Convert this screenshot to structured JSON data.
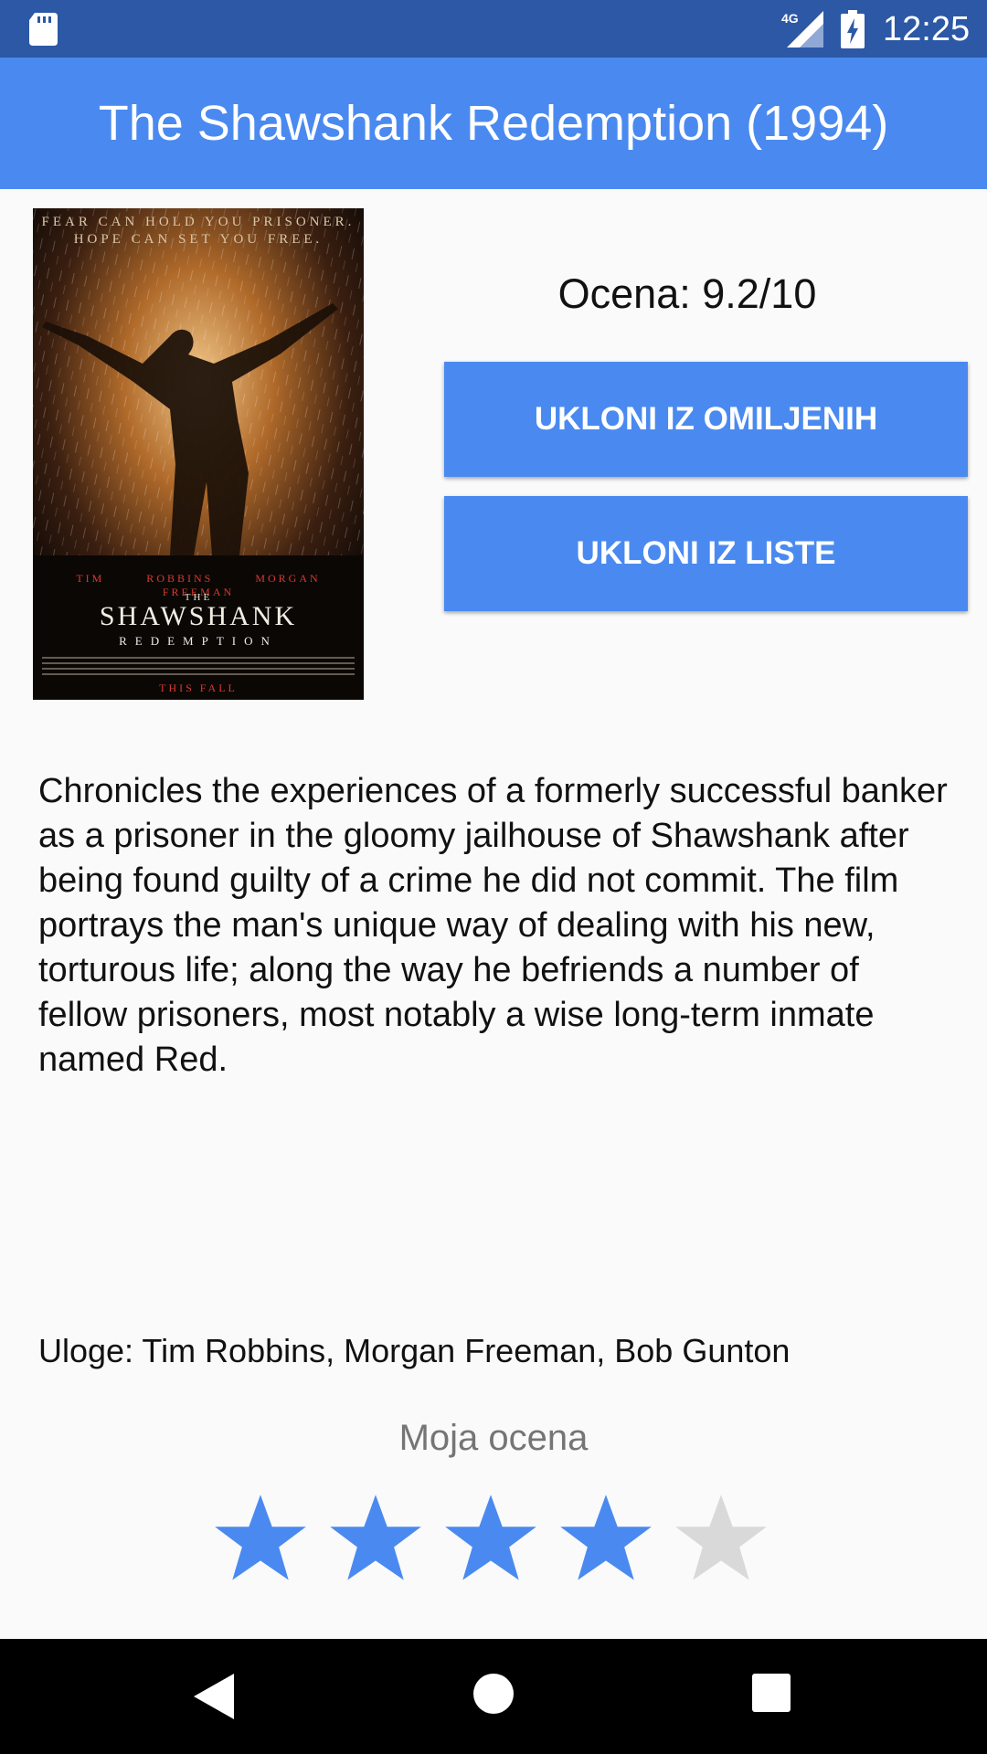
{
  "status_bar": {
    "time": "12:25",
    "network": "4G",
    "icons": [
      "sd-card-icon",
      "signal-icon",
      "battery-charging-icon"
    ]
  },
  "app_bar": {
    "title": "The Shawshank Redemption (1994)"
  },
  "poster": {
    "tagline_line1": "FEAR CAN HOLD YOU PRISONER.",
    "tagline_line2": "HOPE CAN SET YOU FREE.",
    "actors": "TIM ROBBINS MORGAN FREEMAN",
    "logo_the": "THE",
    "logo_main": "SHAWSHANK",
    "logo_sub": "REDEMPTION",
    "release": "THIS FALL"
  },
  "movie": {
    "rating_text": "Ocena: 9.2/10",
    "description": "Chronicles the experiences of a formerly successful banker as a prisoner in the gloomy jailhouse of Shawshank after being found guilty of a crime he did not commit. The film portrays the man's unique way of dealing with his new, torturous life; along the way he befriends a number of fellow prisoners, most notably a wise long-term inmate named Red.",
    "cast_text": "Uloge: Tim Robbins, Morgan Freeman, Bob Gunton"
  },
  "actions": {
    "remove_favorites_label": "UKLONI IZ OMILJENIH",
    "remove_list_label": "UKLONI IZ LISTE"
  },
  "user_rating": {
    "label": "Moja ocena",
    "value": 4,
    "max": 5
  },
  "colors": {
    "status_bar": "#2c58a6",
    "primary": "#4a8af0",
    "star_filled": "#4a8af0",
    "star_empty": "#d9d9d9",
    "nav_bar": "#000000"
  }
}
